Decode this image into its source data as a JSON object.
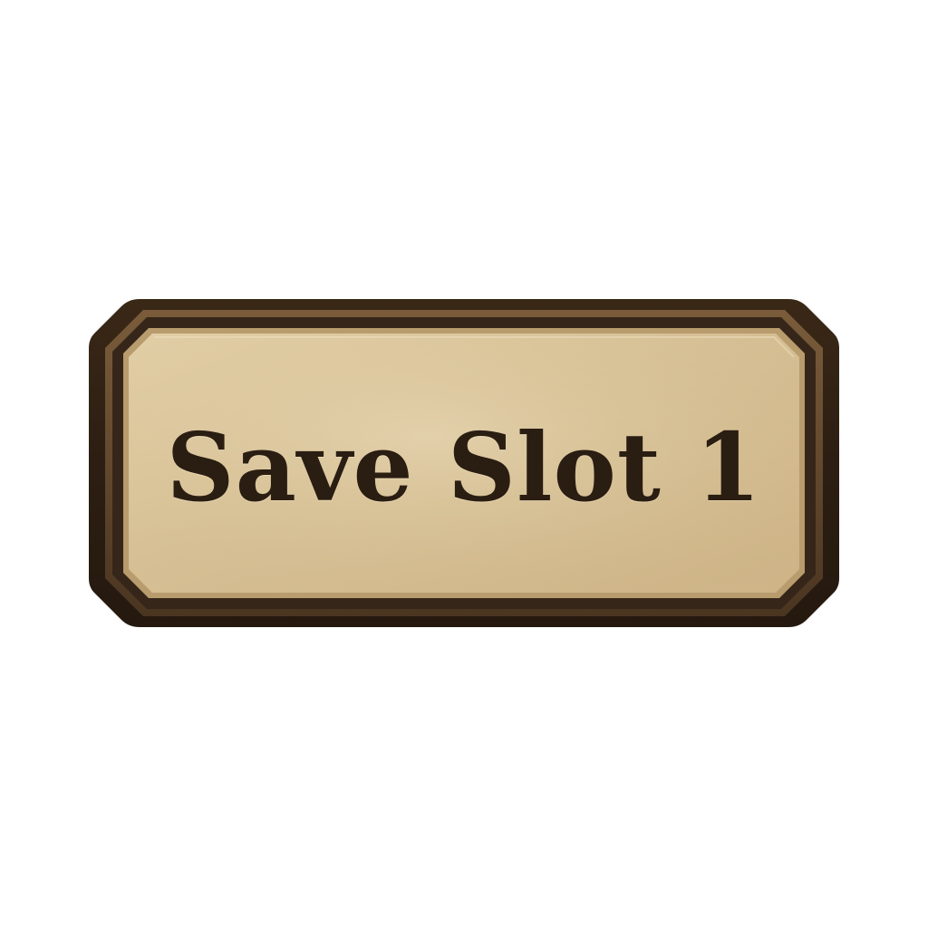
{
  "save_slot": {
    "label": "Save Slot 1"
  },
  "palette": {
    "frame_dark": "#2e2014",
    "frame_mid": "#4a3621",
    "frame_light": "#6b5033",
    "parchment": "#d8c299",
    "parchment_light": "#e6d4ad",
    "text": "#2a1d12"
  }
}
